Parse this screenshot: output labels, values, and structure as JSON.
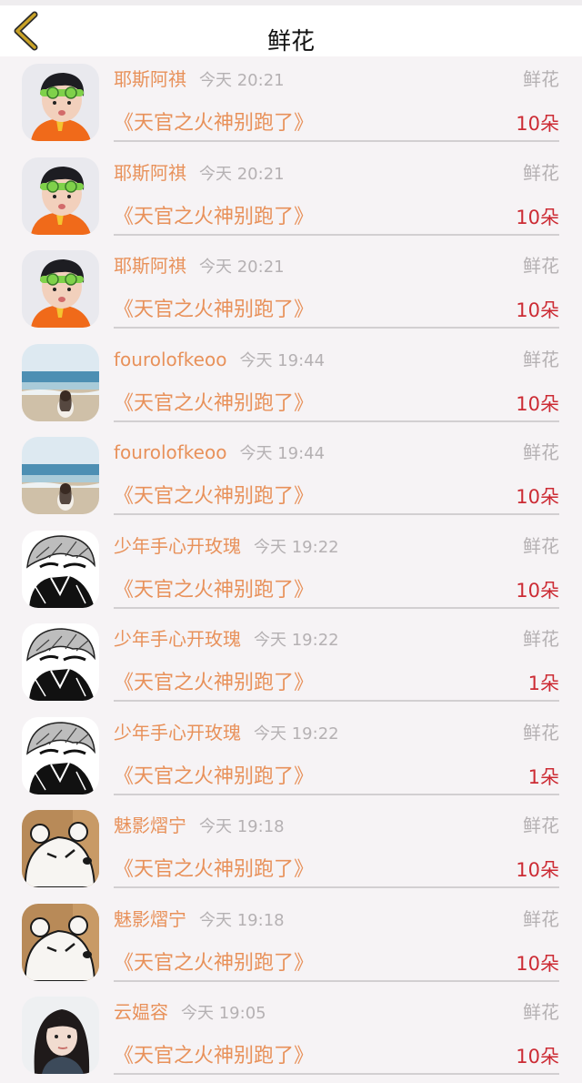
{
  "header": {
    "title": "鲜花",
    "back_icon": "chevron-left-icon",
    "back_color": "#c9a227"
  },
  "colors": {
    "username": "#e8915a",
    "muted": "#b5b1b3",
    "count": "#cc2b34"
  },
  "records": [
    {
      "user": "耶斯阿祺",
      "time": "今天 20:21",
      "type": "鲜花",
      "book": "《天官之火神别跑了》",
      "count": "10朵",
      "avatar": "boy-avatar"
    },
    {
      "user": "耶斯阿祺",
      "time": "今天 20:21",
      "type": "鲜花",
      "book": "《天官之火神别跑了》",
      "count": "10朵",
      "avatar": "boy-avatar"
    },
    {
      "user": "耶斯阿祺",
      "time": "今天 20:21",
      "type": "鲜花",
      "book": "《天官之火神别跑了》",
      "count": "10朵",
      "avatar": "boy-avatar"
    },
    {
      "user": "fourolofkeoo",
      "time": "今天 19:44",
      "type": "鲜花",
      "book": "《天官之火神别跑了》",
      "count": "10朵",
      "avatar": "beach-avatar"
    },
    {
      "user": "fourolofkeoo",
      "time": "今天 19:44",
      "type": "鲜花",
      "book": "《天官之火神别跑了》",
      "count": "10朵",
      "avatar": "beach-avatar"
    },
    {
      "user": "少年手心开玫瑰",
      "time": "今天 19:22",
      "type": "鲜花",
      "book": "《天官之火神别跑了》",
      "count": "10朵",
      "avatar": "manga-avatar"
    },
    {
      "user": "少年手心开玫瑰",
      "time": "今天 19:22",
      "type": "鲜花",
      "book": "《天官之火神别跑了》",
      "count": "1朵",
      "avatar": "manga-avatar"
    },
    {
      "user": "少年手心开玫瑰",
      "time": "今天 19:22",
      "type": "鲜花",
      "book": "《天官之火神别跑了》",
      "count": "1朵",
      "avatar": "manga-avatar"
    },
    {
      "user": "魅影熠宁",
      "time": "今天 19:18",
      "type": "鲜花",
      "book": "《天官之火神别跑了》",
      "count": "10朵",
      "avatar": "bear-avatar"
    },
    {
      "user": "魅影熠宁",
      "time": "今天 19:18",
      "type": "鲜花",
      "book": "《天官之火神别跑了》",
      "count": "10朵",
      "avatar": "bear-avatar"
    },
    {
      "user": "云媪容",
      "time": "今天 19:05",
      "type": "鲜花",
      "book": "《天官之火神别跑了》",
      "count": "10朵",
      "avatar": "girl-avatar"
    }
  ]
}
